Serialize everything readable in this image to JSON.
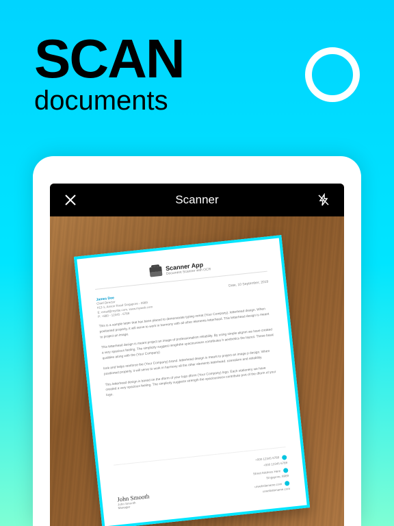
{
  "hero": {
    "title": "SCAN",
    "subtitle": "documents"
  },
  "appbar": {
    "title": "Scanner"
  },
  "doc": {
    "app_title": "Scanner App",
    "app_subtitle": "Document Scanner with OCR",
    "sender_name": "James Doe",
    "sender_role": "Chief Director",
    "sender_addr": "#12-1, Anson Road Singapore - 0989",
    "sender_email": "E: email@mysite.com, www.myweb.com",
    "sender_phone": "P: +880 - 12345 - 6789",
    "date": "Date, 10 September, 2019",
    "p1": "This is a sample letter that has been placed to demonstrate typing remat (Your Company). letterhead design. When positioned properly, it will serve to work in harmony with all other elements letterhead. This letterhead design is meant to project an image.",
    "p2": "This letterhead design is meant project an image of professionalism reliability. By using simple alignm we have created a very spacious feeling. The simplicity suggest  rengththe spaciousness contributes h aesthetics the layout. These basic qualities along with the (Your Company)",
    "p3": "look and helps reinforce the (Your Company) brand. letterhead design is meant to project an image p design. When positioned properly, it will serve to work in harmony all the other elements letterhead. ozenalizm and reliability.",
    "p4": "This letterhead design is based on the dform of your logo dform (Your Company) logo. Each stationery we have created a very spacious feeling. The simplicity suggests strength the spaciousness contribute port of the dform of your logo.",
    "signature": "John Smooth",
    "sig_name": "John Smooth",
    "sig_role": "Manager",
    "contact_phone1": "+000 12345 6789",
    "contact_phone2": "+000 12345 6789",
    "contact_addr1": "Street Address Here",
    "contact_addr2": "Singapore, 8989",
    "contact_email1": "urwebsitename.com",
    "contact_email2": "urwebsitename.com"
  }
}
